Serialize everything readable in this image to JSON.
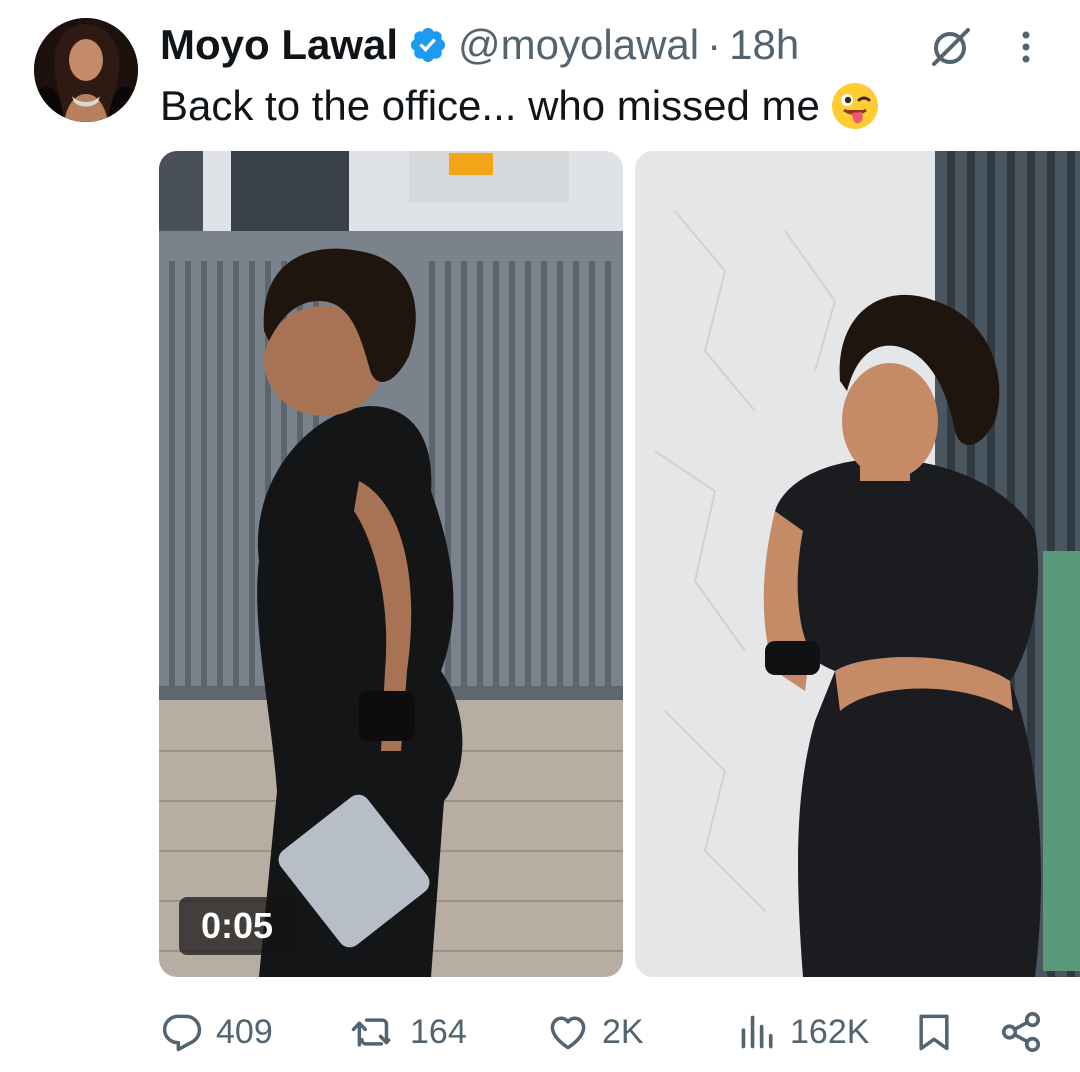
{
  "author": {
    "display_name": "Moyo Lawal",
    "handle": "@moyolawal",
    "separator": "·",
    "time": "18h"
  },
  "post": {
    "text": "Back to the office... who missed me",
    "emoji": "winking-face-with-tongue"
  },
  "media": {
    "items": [
      {
        "kind": "video",
        "duration": "0:05"
      },
      {
        "kind": "image"
      }
    ]
  },
  "actions": {
    "replies": "409",
    "reposts": "164",
    "likes": "2K",
    "views": "162K"
  },
  "colors": {
    "text": "#0f1419",
    "secondary": "#536471",
    "verified": "#1d9bf0",
    "background": "#ffffff"
  },
  "icons": [
    "verified-badge-icon",
    "grok-icon",
    "more-icon",
    "reply-icon",
    "repost-icon",
    "like-icon",
    "views-icon",
    "bookmark-icon",
    "share-icon"
  ]
}
